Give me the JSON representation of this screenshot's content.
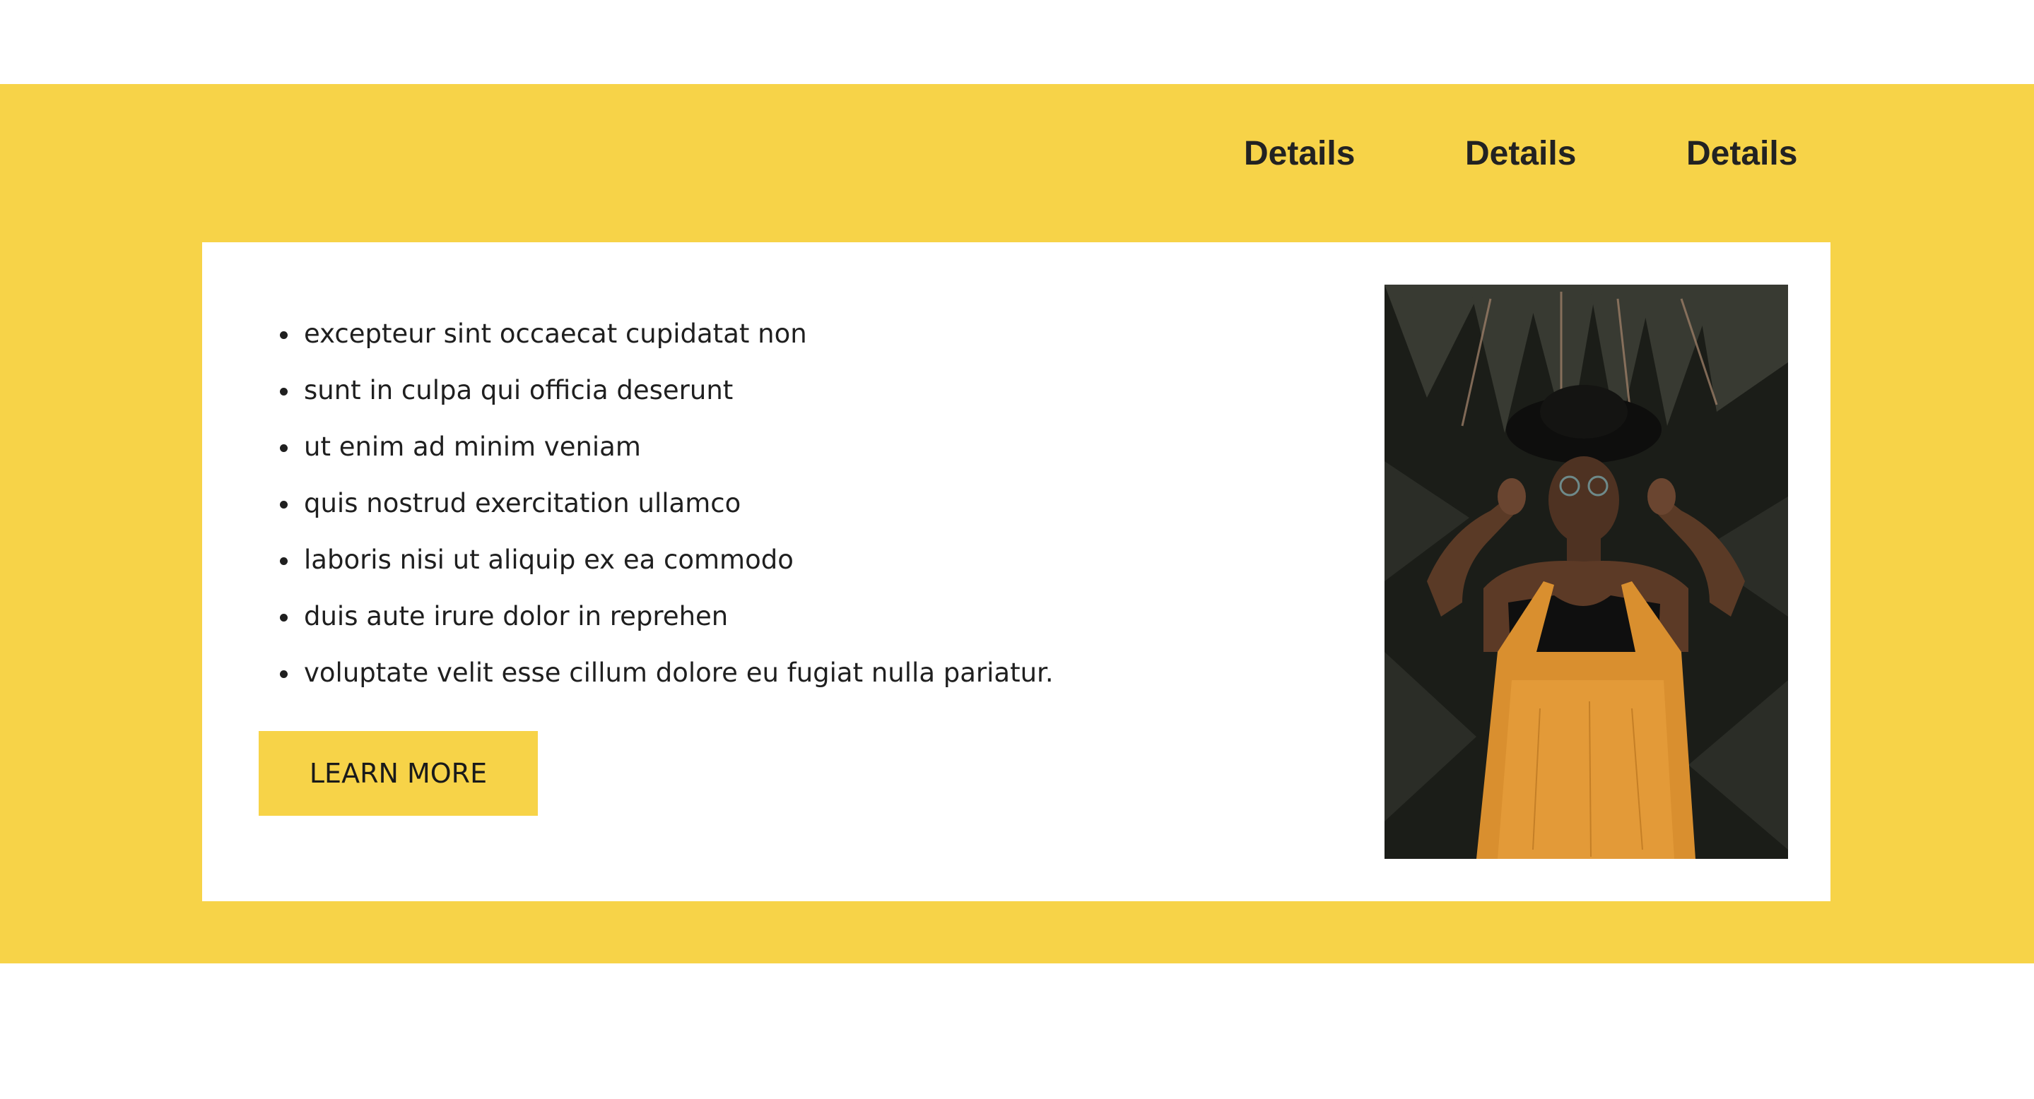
{
  "nav": {
    "links": [
      "Details",
      "Details",
      "Details"
    ]
  },
  "features": [
    "excepteur sint occaecat cupidatat non",
    "sunt in culpa qui officia deserunt",
    "ut enim ad minim veniam",
    "quis nostrud exercitation ullamco",
    "laboris nisi ut aliquip ex ea commodo",
    "duis aute irure dolor in reprehen",
    "voluptate velit esse cillum dolore eu fugiat nulla pariatur."
  ],
  "cta": {
    "label": "LEARN MORE"
  },
  "colors": {
    "accent": "#f7d348",
    "text": "#1f1f1f",
    "nav_text": "#222222",
    "card": "#ffffff"
  }
}
